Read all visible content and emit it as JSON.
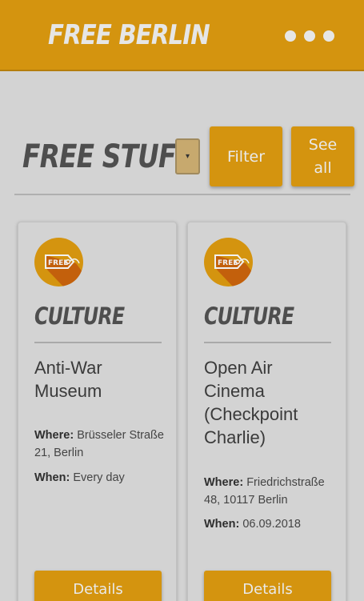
{
  "header": {
    "brand": "FREE BERLIN",
    "menu_icon": "more-dots-icon"
  },
  "toolbar": {
    "section_title": "FREE STUFF",
    "select_indicator": "▾",
    "filter_label": "Filter",
    "see_all_label": "See all"
  },
  "cards": [
    {
      "badge_text": "FREE",
      "badge_icon": "free-ticket-icon",
      "category": "CULTURE",
      "title": "Anti-War Museum",
      "where_label": "Where:",
      "where_value": "Brüsseler Straße 21, Berlin",
      "when_label": "When:",
      "when_value": "Every day",
      "details_label": "Details"
    },
    {
      "badge_text": "FREE",
      "badge_icon": "free-ticket-icon",
      "category": "CULTURE",
      "title": "Open Air Cinema (Checkpoint Charlie)",
      "where_label": "Where:",
      "where_value": "Friedrichstraße 48, 10117 Berlin",
      "when_label": "When:",
      "when_value": "06.09.2018",
      "details_label": "Details"
    }
  ],
  "colors": {
    "accent": "#d4940f",
    "background": "#d3d3d3",
    "heading": "#4e4e4e"
  }
}
